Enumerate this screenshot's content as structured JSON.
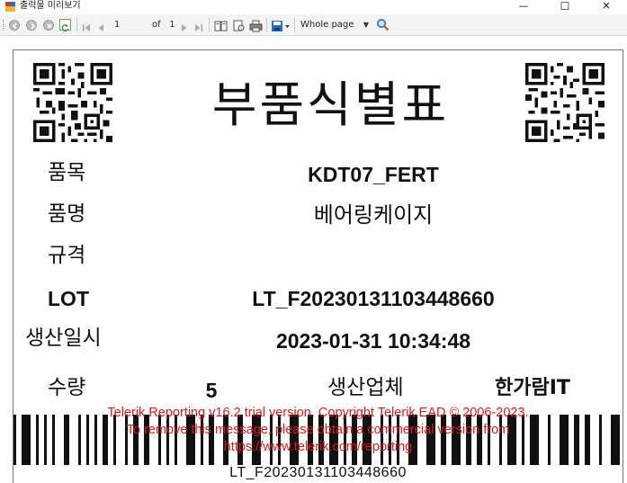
{
  "window": {
    "title": "출력물 미리보기",
    "minimize_glyph": "—",
    "maximize_glyph": "☐",
    "close_glyph": "✕"
  },
  "toolbar": {
    "back_icon": "back-icon",
    "forward_icon": "forward-icon",
    "stop_icon": "stop-icon",
    "refresh_icon": "refresh-icon",
    "current_page": "1",
    "of_label": "of",
    "total_pages": "1",
    "zoom_value": "Whole page",
    "accent_color": "#2d6cc0"
  },
  "report": {
    "title": "부품식별표",
    "rows": {
      "part_no_label": "품목",
      "part_no_value": "KDT07_FERT",
      "part_name_label": "품명",
      "part_name_value": "베어링케이지",
      "spec_label": "규격",
      "spec_value": "",
      "lot_label": "LOT",
      "lot_value": "LT_F20230131103448660",
      "produced_label": "생산일시",
      "produced_value": "2023-01-31 10:34:48",
      "qty_label": "수량",
      "qty_value": "5",
      "maker_label": "생산업체",
      "maker_value": "한가람IT"
    },
    "barcode_text": "LT_F20230131103448660",
    "watermark": {
      "line1": "Telerik Reporting v16.2 trial version. Copyright Telerik EAD © 2006-2023.",
      "line2": "To remove this message, please obtain a commercial version from",
      "line3": "https://www.telerik.com/reporting",
      "color": "#e8161b"
    }
  }
}
